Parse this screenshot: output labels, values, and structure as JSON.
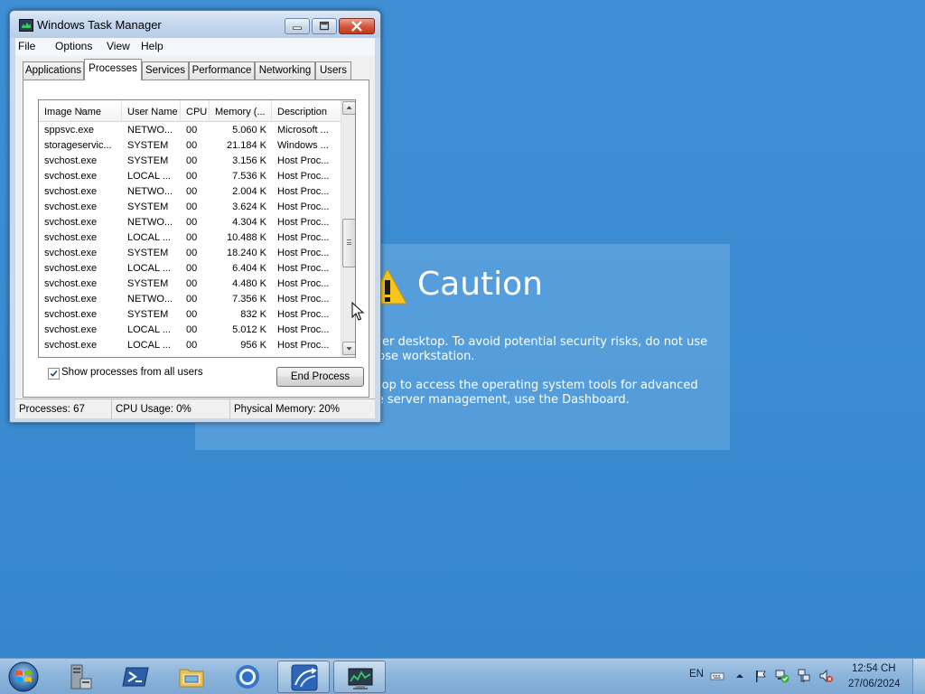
{
  "window": {
    "title": "Windows Task Manager",
    "menu": [
      "File",
      "Options",
      "View",
      "Help"
    ]
  },
  "tabs": [
    "Applications",
    "Processes",
    "Services",
    "Performance",
    "Networking",
    "Users"
  ],
  "active_tab": "Processes",
  "columns": [
    "Image Name",
    "User Name",
    "CPU",
    "Memory (...",
    "Description"
  ],
  "processes": [
    [
      "sppsvc.exe",
      "NETWO...",
      "00",
      "5.060 K",
      "Microsoft ..."
    ],
    [
      "storageservic...",
      "SYSTEM",
      "00",
      "21.184 K",
      "Windows ..."
    ],
    [
      "svchost.exe",
      "SYSTEM",
      "00",
      "3.156 K",
      "Host Proc..."
    ],
    [
      "svchost.exe",
      "LOCAL ...",
      "00",
      "7.536 K",
      "Host Proc..."
    ],
    [
      "svchost.exe",
      "NETWO...",
      "00",
      "2.004 K",
      "Host Proc..."
    ],
    [
      "svchost.exe",
      "SYSTEM",
      "00",
      "3.624 K",
      "Host Proc..."
    ],
    [
      "svchost.exe",
      "NETWO...",
      "00",
      "4.304 K",
      "Host Proc..."
    ],
    [
      "svchost.exe",
      "LOCAL ...",
      "00",
      "10.488 K",
      "Host Proc..."
    ],
    [
      "svchost.exe",
      "SYSTEM",
      "00",
      "18.240 K",
      "Host Proc..."
    ],
    [
      "svchost.exe",
      "LOCAL ...",
      "00",
      "6.404 K",
      "Host Proc..."
    ],
    [
      "svchost.exe",
      "SYSTEM",
      "00",
      "4.480 K",
      "Host Proc..."
    ],
    [
      "svchost.exe",
      "NETWO...",
      "00",
      "7.356 K",
      "Host Proc..."
    ],
    [
      "svchost.exe",
      "SYSTEM",
      "00",
      "832 K",
      "Host Proc..."
    ],
    [
      "svchost.exe",
      "LOCAL ...",
      "00",
      "5.012 K",
      "Host Proc..."
    ],
    [
      "svchost.exe",
      "LOCAL ...",
      "00",
      "956 K",
      "Host Proc..."
    ]
  ],
  "controls": {
    "show_all_label": "Show processes from all users",
    "show_all_checked": true,
    "end_process_label": "End Process"
  },
  "status": {
    "processes": "Processes: 67",
    "cpu": "CPU Usage: 0%",
    "memory": "Physical Memory: 20%"
  },
  "caution": {
    "title": "Caution",
    "text1": "rver desktop. To avoid potential security risks, do not use pose workstation.",
    "text2": "ktop to access the operating system tools for advanced se server management, use the Dashboard."
  },
  "taskbar": {
    "apps": [
      "server-manager-icon",
      "powershell-icon",
      "file-explorer-icon",
      "chrome-icon",
      "remote-desktop-icon",
      "task-manager-icon"
    ],
    "language": "EN",
    "time": "12:54 CH",
    "date": "27/06/2024"
  },
  "colors": {
    "desktop": "#3d8fd3",
    "accent": "#3399ff"
  }
}
